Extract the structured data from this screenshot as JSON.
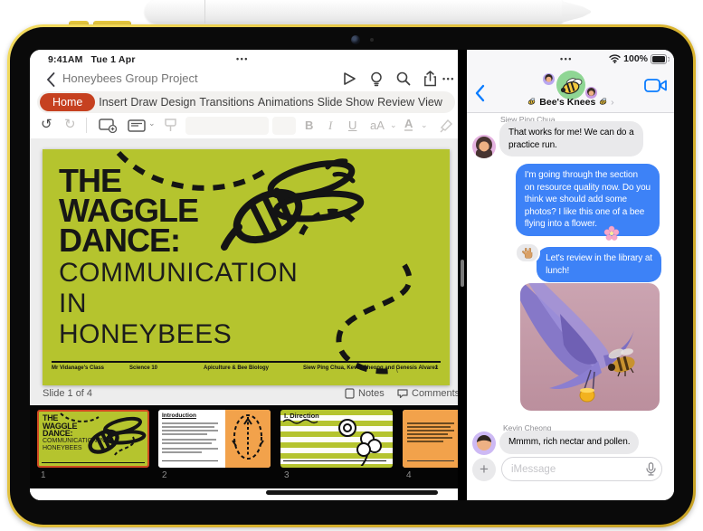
{
  "statusbar": {
    "time": "9:41AM",
    "date": "Tue 1 Apr",
    "battery": "100%"
  },
  "icons": {
    "app_menu_dots": "•••",
    "undo": "↺",
    "redo": "↻",
    "chevron_down": "⌄",
    "back_chevron": "‹",
    "forward_chevron": "›",
    "plus": "+"
  },
  "powerpoint": {
    "nav": {
      "title": "Honeybees Group Project"
    },
    "ribbon": {
      "tabs": [
        "Home",
        "Insert",
        "Draw",
        "Design",
        "Transitions",
        "Animations",
        "Slide Show",
        "Review",
        "View"
      ]
    },
    "toolbar": {
      "bold": "B",
      "italic": "I",
      "underline": "U",
      "case": "aA",
      "color": "A"
    },
    "slide": {
      "title_lines": [
        "THE",
        "WAGGLE",
        "DANCE:"
      ],
      "subtitle_lines": [
        "COMMUNICATION",
        "IN",
        "HONEYBEES"
      ],
      "footer": [
        "Mr Vidanage's Class",
        "Science 10",
        "Apiculture & Bee Biology",
        "Siew Ping Chua, Kevin Cheong and Genesis Alvarez",
        "1"
      ]
    },
    "bottombar": {
      "slide_label": "Slide 1 of 4",
      "notes": "Notes",
      "comments": "Comments"
    },
    "thumbnails": [
      {
        "num": "1",
        "title": "THE WAGGLE DANCE:",
        "subtitle": "COMMUNICATION IN HONEYBEES",
        "selected": true
      },
      {
        "num": "2",
        "title": "Introduction"
      },
      {
        "num": "3",
        "title": "I. Direction"
      },
      {
        "num": "4",
        "title": ""
      }
    ],
    "colors": {
      "slide_green": "#b5c42e",
      "slide_orange": "#f2a24b",
      "home_tab": "#c64120"
    }
  },
  "messages": {
    "header": {
      "group_name": "Bee's Knees",
      "bee_emoji": "🐝"
    },
    "conversation": [
      {
        "type": "received",
        "sender": "Siew Ping Chua",
        "text": "That works for me! We can do a\npractice run."
      },
      {
        "type": "sent",
        "text": "I'm going through the section\non resource quality now. Do you\nthink we should add some\nphotos? I like this one of a bee\nflying into a flower.",
        "emoji": "🌸"
      },
      {
        "type": "sent",
        "text": "Let's review in the library at\nlunch!",
        "reaction": "🤟"
      },
      {
        "type": "photo",
        "photo_label": "bee-flying-to-purple-flower-photo"
      },
      {
        "type": "received",
        "sender": "Kevin Cheong",
        "text": "Mmmm, rich nectar and pollen."
      }
    ],
    "input": {
      "placeholder": "iMessage"
    },
    "colors": {
      "sent_blue": "#3d82f7",
      "received_gray": "#e9e9eb",
      "accent_blue": "#0a7cff"
    }
  }
}
